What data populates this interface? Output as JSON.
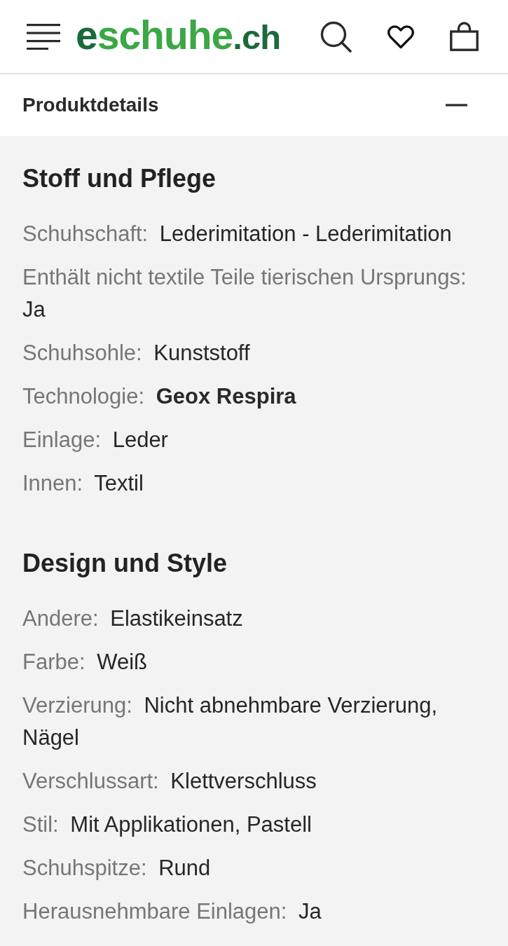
{
  "header": {
    "logo": [
      {
        "text": "e",
        "kind": "dark"
      },
      {
        "text": "schuhe",
        "kind": "light"
      },
      {
        "text": ".ch",
        "kind": "dark"
      }
    ]
  },
  "product_details": {
    "title": "Produktdetails",
    "expanded": true,
    "sections": [
      {
        "heading": "Stoff und Pflege",
        "rows": [
          {
            "label": "Schuhschaft:",
            "value": "Lederimitation - Lederimitation",
            "emphasized": false
          },
          {
            "label": "Enthält nicht textile Teile tierischen Ursprungs:",
            "value": "Ja",
            "emphasized": false
          },
          {
            "label": "Schuhsohle:",
            "value": "Kunststoff",
            "emphasized": false
          },
          {
            "label": "Technologie:",
            "value": "Geox Respira",
            "emphasized": true
          },
          {
            "label": "Einlage:",
            "value": "Leder",
            "emphasized": false
          },
          {
            "label": "Innen:",
            "value": "Textil",
            "emphasized": false
          }
        ]
      },
      {
        "heading": "Design und Style",
        "rows": [
          {
            "label": "Andere:",
            "value": "Elastikeinsatz",
            "emphasized": false
          },
          {
            "label": "Farbe:",
            "value": "Weiß",
            "emphasized": false
          },
          {
            "label": "Verzierung:",
            "value": "Nicht abnehmbare Verzierung, Nägel",
            "emphasized": false
          },
          {
            "label": "Verschlussart:",
            "value": "Klettverschluss",
            "emphasized": false
          },
          {
            "label": "Stil:",
            "value": "Mit Applikationen, Pastell",
            "emphasized": false
          },
          {
            "label": "Schuhspitze:",
            "value": "Rund",
            "emphasized": false
          },
          {
            "label": "Herausnehmbare Einlagen:",
            "value": "Ja",
            "emphasized": false
          }
        ]
      }
    ]
  }
}
